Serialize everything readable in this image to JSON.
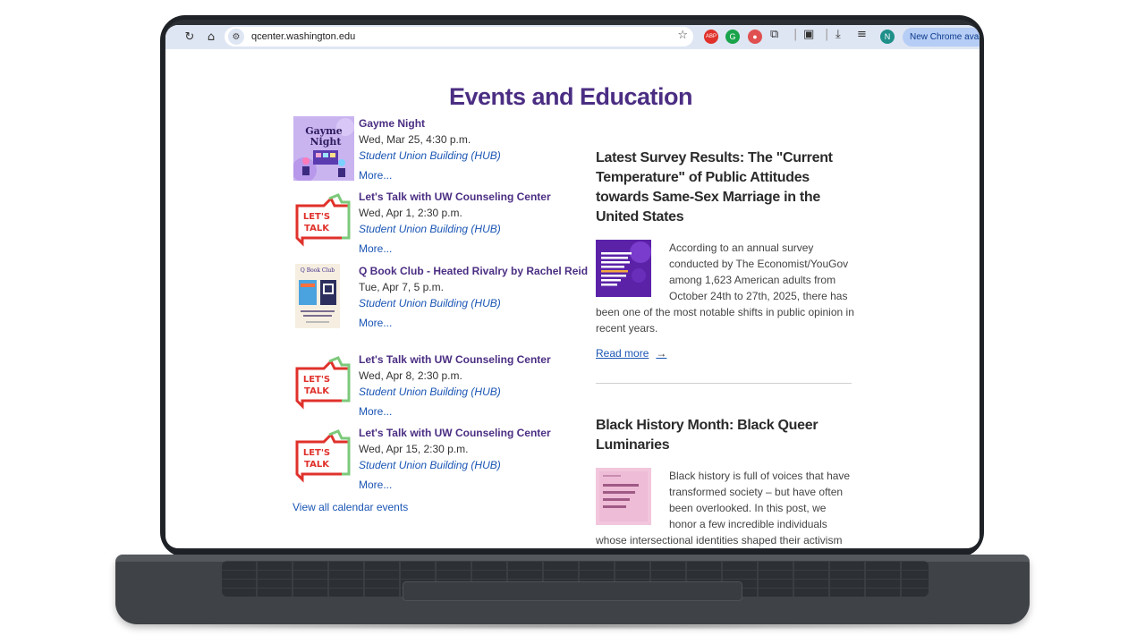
{
  "browser": {
    "url": "qcenter.washington.edu",
    "update_label": "New Chrome avail",
    "profile_initial": "N",
    "ext_abp": "ABP"
  },
  "page": {
    "title": "Events and Education",
    "view_all": "View all calendar events"
  },
  "events": [
    {
      "title": "Gayme Night",
      "date": "Wed, Mar 25, 4:30 p.m.",
      "location": "Student Union Building (HUB)",
      "more": "More...",
      "thumb_text": "Gayme Night"
    },
    {
      "title": "Let's Talk with UW Counseling Center",
      "date": "Wed, Apr 1, 2:30 p.m.",
      "location": "Student Union Building (HUB)",
      "more": "More...",
      "thumb_text": "LET'S TALK"
    },
    {
      "title": "Q Book Club - Heated Rivalry by Rachel Reid",
      "date": "Tue, Apr 7, 5 p.m.",
      "location": "Student Union Building (HUB)",
      "more": "More...",
      "thumb_text": "Q Book Club"
    },
    {
      "title": "Let's Talk with UW Counseling Center",
      "date": "Wed, Apr 8, 2:30 p.m.",
      "location": "Student Union Building (HUB)",
      "more": "More...",
      "thumb_text": "LET'S TALK"
    },
    {
      "title": "Let's Talk with UW Counseling Center",
      "date": "Wed, Apr 15, 2:30 p.m.",
      "location": "Student Union Building (HUB)",
      "more": "More...",
      "thumb_text": "LET'S TALK"
    }
  ],
  "articles": [
    {
      "title": "Latest Survey Results: The \"Current Temperature\" of Public Attitudes towards Same-Sex Marriage in the United States",
      "body": "According to an annual survey conducted by The Economist/YouGov among 1,623 American adults from October 24th to 27th, 2025, there has been one of the most notable shifts in public opinion in recent years.",
      "read_more": "Read more",
      "thumb_text": "THE \"CURRENT TEMPERATURE\" OF PUBLIC ATTITUDES TOWARDS SAME-SEX MARRIAGE IN THE UNITED STATES"
    },
    {
      "title": "Black History Month: Black Queer Luminaries",
      "body": "Black history is full of voices that have transformed society – but have often been overlooked. In this post, we honor a few incredible individuals whose intersectional identities shaped their activism and whose legacies continue to inspire us today.",
      "thumb_text": "THE PEOPLE WHO AIDED IN BLACK HISTORY"
    }
  ],
  "colors": {
    "uw_purple": "#4b2e83",
    "link_blue": "#1a55b4"
  }
}
